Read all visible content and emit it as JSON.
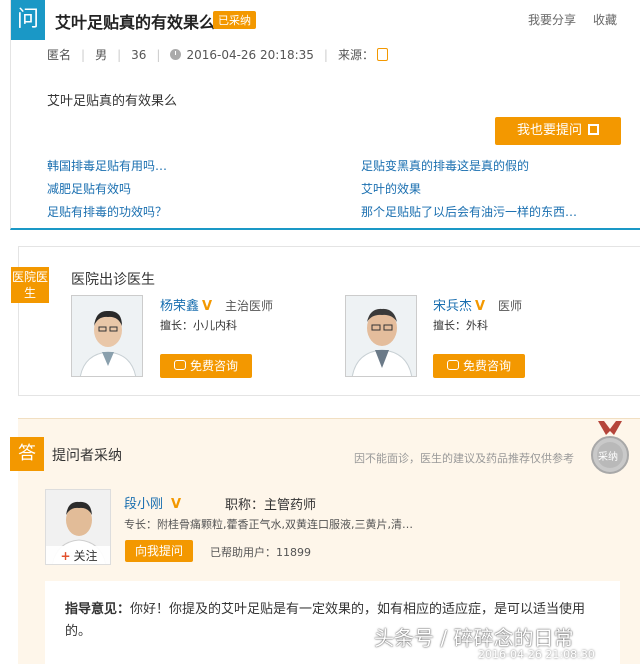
{
  "question": {
    "badge": "问",
    "title": "艾叶足贴真的有效果么",
    "status": "已采纳",
    "share": "我要分享",
    "favorite": "收藏",
    "meta": {
      "name": "匿名",
      "gender": "男",
      "age": "36",
      "datetime": "2016-04-26 20:18:35",
      "source_label": "来源："
    },
    "body": "艾叶足贴真的有效果么",
    "ask_button": "我也要提问",
    "related": [
      "韩国排毒足贴有用吗…",
      "足贴变黑真的排毒这是真的假的",
      "减肥足贴有效吗",
      "艾叶的效果",
      "足贴有排毒的功效吗？",
      "那个足贴贴了以后会有油污一样的东西…"
    ]
  },
  "hospital": {
    "badge": "医院医生",
    "title": "医院出诊医生",
    "doctors": [
      {
        "name": "杨荣鑫",
        "title": "主治医师",
        "specialty": "擅长：小儿内科",
        "button": "免费咨询"
      },
      {
        "name": "宋兵杰",
        "title": "医师",
        "specialty": "擅长：外科",
        "button": "免费咨询"
      }
    ]
  },
  "answer": {
    "badge": "答",
    "title": "提问者采纳",
    "note": "因不能面诊，医生的建议及药品推荐仅供参考",
    "medal": "采纳",
    "doctor": {
      "follow": "关注",
      "name": "段小刚",
      "rank": "职称：主管药师",
      "specialty": "专长：附桂骨痛颗粒,藿香正气水,双黄连口服液,三黄片,清…",
      "ask_button": "向我提问",
      "helped": "已帮助用户：11899"
    },
    "opinion_label": "指导意见：",
    "opinion_text": "你好！你提及的艾叶足贴是有一定效果的，如有相应的适应症，是可以适当使用的。"
  },
  "watermark": {
    "text": "头条号 / 碎碎念的日常",
    "timestamp": "2016-04-26 21:08:30"
  },
  "colors": {
    "blue": "#1a98c6",
    "orange": "#f39800",
    "link": "#1a6fb0"
  }
}
